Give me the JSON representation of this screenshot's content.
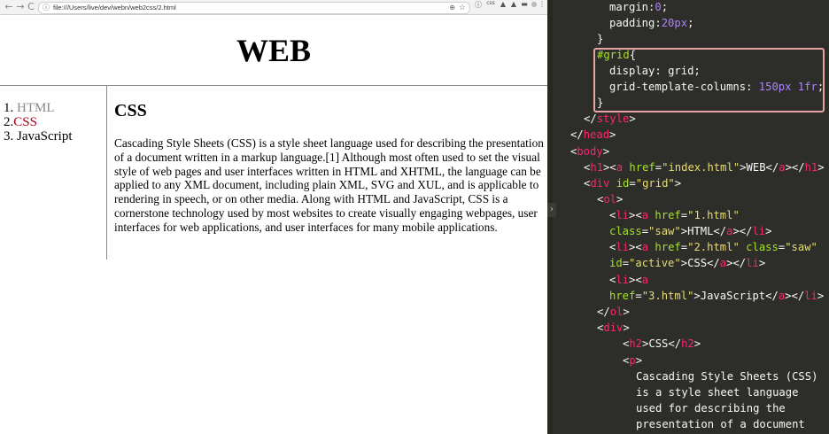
{
  "browser": {
    "url": "file:///Users/live/dev/webn/web2css/2.html",
    "nav": {
      "back": "←",
      "forward": "→",
      "reload": "C"
    },
    "omnibox": {
      "info_icon": "info-icon",
      "zoom_icon": "zoom-icon",
      "star_icon": "star-icon"
    },
    "extensions": [
      "css",
      "ext",
      "ext",
      "ext",
      "ext",
      "ext",
      "⋮"
    ]
  },
  "page": {
    "site_title": "WEB",
    "nav": [
      {
        "num": "1.",
        "label": "HTML"
      },
      {
        "num": "2.",
        "label": "CSS"
      },
      {
        "num": "3.",
        "label": "JavaScript"
      }
    ],
    "heading": "CSS",
    "paragraph": "Cascading Style Sheets (CSS) is a style sheet language used for describing the presentation of a document written in a markup language.[1] Although most often used to set the visual style of web pages and user interfaces written in HTML and XHTML, the language can be applied to any XML document, including plain XML, SVG and XUL, and is applicable to rendering in speech, or on other media. Along with HTML and JavaScript, CSS is a cornerstone technology used by most websites to create visually engaging webpages, user interfaces for web applications, and user interfaces for many mobile applications."
  },
  "editor": {
    "handle": "›",
    "code": {
      "l1_prop": "margin",
      "l1_val": "0",
      "l2_prop": "padding",
      "l2_val": "20px",
      "l3": "}",
      "l4_sel": "#grid",
      "l4_brace": "{",
      "l5_prop": "display",
      "l5_val": "grid",
      "l6_prop": "grid-template-columns",
      "l6_val": "150px 1fr",
      "l7": "}",
      "l8_tag": "style",
      "l9_tag": "head",
      "l10_tag": "body",
      "l11_tag": "h1",
      "l11_a": "a",
      "l11_attr": "href",
      "l11_str": "\"index.html\"",
      "l11_text": "WEB",
      "l12_tag": "div",
      "l12_attr": "id",
      "l12_str": "\"grid\"",
      "l13_tag": "ol",
      "l14_tag": "li",
      "l14_a": "a",
      "l14_attr": "href",
      "l14_str": "\"1.html\"",
      "l15_attr": "class",
      "l15_str": "\"saw\"",
      "l15_text": "HTML",
      "l16_tag": "li",
      "l16_a": "a",
      "l16_attr": "href",
      "l16_str": "\"2.html\"",
      "l16_attr2": "class",
      "l16_str2": "\"saw\"",
      "l17_attr": "id",
      "l17_str": "\"active\"",
      "l17_text": "CSS",
      "l18_tag": "li",
      "l18_a": "a",
      "l19_attr": "href",
      "l19_str": "\"3.html\"",
      "l19_text": "JavaScript",
      "l20_tag": "ol",
      "l21_tag": "div",
      "l22_tag": "h2",
      "l22_text": "CSS",
      "l23_tag": "p",
      "l24": "Cascading Style Sheets (CSS)",
      "l25": "is a style sheet language",
      "l26": "used for describing the",
      "l27": "presentation of a document"
    }
  },
  "colors": {
    "editor_bg": "#2d2e29",
    "tag": "#f92672",
    "attr": "#a6e22e",
    "string": "#e6db74",
    "number": "#ae81ff",
    "property": "#66d9ef",
    "highlight_box": "#e8a3a3",
    "active_link": "#a6001a",
    "visited_link": "#888888"
  }
}
